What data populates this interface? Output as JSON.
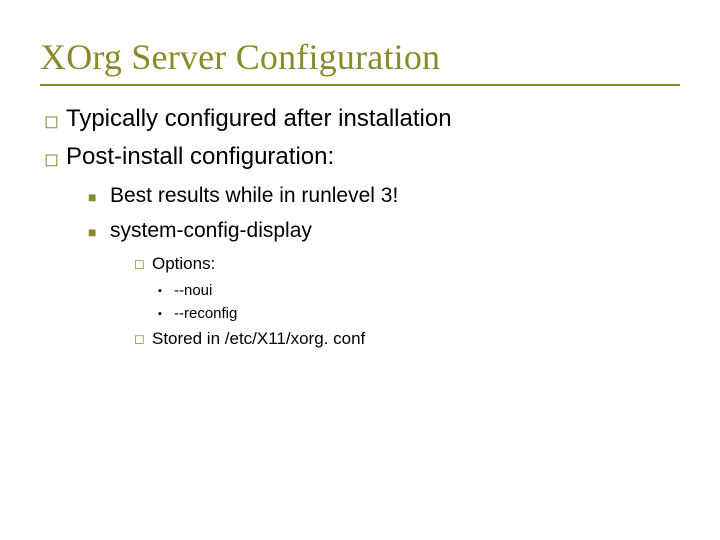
{
  "title": "XOrg Server Configuration",
  "l1": [
    "Typically configured after installation",
    "Post-install configuration:"
  ],
  "l2": [
    "Best results while in runlevel 3!",
    "system-config-display"
  ],
  "l3_a": "Options:",
  "l4": [
    "--noui",
    "--reconfig"
  ],
  "l3_b": "Stored in /etc/X11/xorg. conf"
}
